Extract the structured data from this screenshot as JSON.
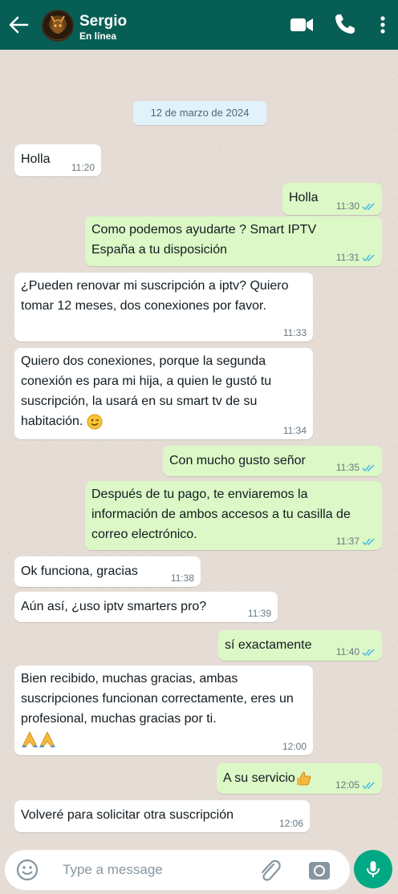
{
  "header": {
    "contact_name": "Sergio",
    "status": "En línea",
    "colors": {
      "bar": "#075e54",
      "accent": "#00a884"
    }
  },
  "chat": {
    "date_chip": "12 de marzo de 2024",
    "messages": [
      {
        "direction": "in",
        "text": "Holla",
        "time": "11:20"
      },
      {
        "direction": "out",
        "text": "Holla",
        "time": "11:30",
        "read": true
      },
      {
        "direction": "out",
        "text": "Como podemos ayudarte ? Smart IPTV España a tu disposición",
        "time": "11:31",
        "read": true
      },
      {
        "direction": "in",
        "text": "¿Pueden renovar mi suscripción a iptv? Quiero tomar 12 meses, dos conexiones por favor.",
        "time": "11:33"
      },
      {
        "direction": "in",
        "text": "Quiero dos conexiones, porque la segunda conexión es para mi hija, a quien le gustó tu suscripción, la usará en su smart tv de su habitación.",
        "emoji": "winking-face",
        "time": "11:34"
      },
      {
        "direction": "out",
        "text": "Con mucho gusto señor",
        "time": "11:35",
        "read": true
      },
      {
        "direction": "out",
        "text": "Después de tu pago, te enviaremos la información de ambos accesos a tu casilla de correo electrónico.",
        "time": "11:37",
        "read": true
      },
      {
        "direction": "in",
        "text": "Ok funciona, gracias",
        "time": "11:38"
      },
      {
        "direction": "in",
        "text": "Aún así, ¿uso iptv smarters pro?",
        "time": "11:39"
      },
      {
        "direction": "out",
        "text": "sí exactamente",
        "time": "11:40",
        "read": true
      },
      {
        "direction": "in",
        "text": "Bien recibido, muchas gracias, ambas suscripciones funcionan correctamente, eres un profesional, muchas gracias por ti.",
        "emoji": "folded-hands x2",
        "time": "12:00"
      },
      {
        "direction": "out",
        "text": "A su servicio",
        "emoji": "thumbs-up",
        "time": "12:05",
        "read": true
      },
      {
        "direction": "in",
        "text": "Volveré para solicitar otra suscripción",
        "time": "12:06"
      }
    ]
  },
  "composer": {
    "placeholder": "Type a message"
  },
  "icons": [
    "back-arrow-icon",
    "video-call-icon",
    "phone-icon",
    "more-vertical-icon",
    "emoji-icon",
    "attach-icon",
    "camera-icon",
    "mic-icon",
    "double-check-icon"
  ]
}
